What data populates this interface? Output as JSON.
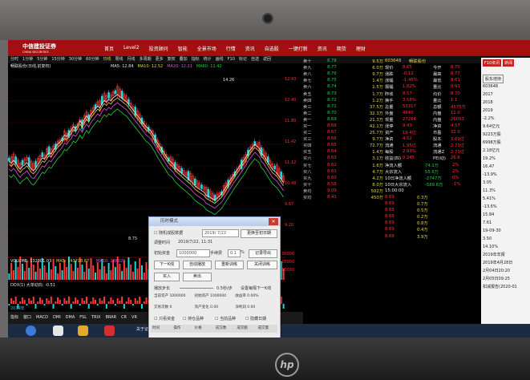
{
  "topbar": {
    "logo": "中信建投证券",
    "logo_sub": "CHINA SECURITIES",
    "nav": [
      "首页",
      "Level2",
      "投资顾问",
      "智能",
      "全景市场",
      "行情",
      "资讯",
      "自选股",
      "一键打新",
      "资讯",
      "期货",
      "理财"
    ],
    "level2_badge": "HOT"
  },
  "menu_tabs": [
    "分时",
    "1分钟",
    "5分钟",
    "15分钟",
    "30分钟",
    "60分钟",
    "日线",
    "周线",
    "月线",
    "多周期",
    "更多",
    "复权",
    "叠加",
    "指标",
    "统计",
    "画线",
    "F10",
    "标记",
    "自选",
    "返回"
  ],
  "chart": {
    "title": "畅联股份(日线,前复权)",
    "ma_labels": [
      {
        "text": "MA5: 12.84",
        "color": "#e6e6e6"
      },
      {
        "text": "MA10: 12.52",
        "color": "#e8d24a"
      },
      {
        "text": "MA20: 12.21",
        "color": "#e050e0"
      },
      {
        "text": "MA60: 11.42",
        "color": "#20d040"
      }
    ],
    "price_high": "14.26",
    "price_low": "8.75",
    "y_ticks": [
      "12.93",
      "12.40",
      "11.80",
      "11.42",
      "11.12",
      "10.48",
      "9.87",
      "9.20"
    ],
    "y_pcts": [
      "19.9%",
      "13.3%",
      "9.6%",
      "3.1%",
      "-3.7%",
      "-9.9%",
      "-16.2%"
    ],
    "volume_label": "VOLUME: 132801.03",
    "vol_ma5": "MA5: 143718.87",
    "vol_ma10": "MA10: 188026",
    "vol_ticks": [
      "30000",
      "20000",
      "10000"
    ],
    "ddx_label": "DDX(1) 大单动向: -0.51",
    "year_label": "2019年",
    "indicator_tabs": [
      "指标",
      "窗口",
      "MACD",
      "DMI",
      "DMA",
      "FSL",
      "TRIX",
      "BRAR",
      "CR",
      "VR"
    ],
    "indicator_tabs2": [
      "扩展",
      "大单",
      "资金博弈",
      "资金分布",
      "大单资金",
      "选股",
      "综合资讯",
      "行业资讯"
    ],
    "orders_label": "交易",
    "order_labels": [
      "DDX"
    ]
  },
  "orderbook": {
    "sells": [
      {
        "label": "卖十",
        "price": "8.78",
        "vol": "9.5万"
      },
      {
        "label": "卖九",
        "price": "8.77",
        "vol": "6.0万"
      },
      {
        "label": "卖八",
        "price": "8.76",
        "vol": "9.7万"
      },
      {
        "label": "卖七",
        "price": "8.75",
        "vol": "1.4万"
      },
      {
        "label": "卖六",
        "price": "8.74",
        "vol": "1.5万"
      },
      {
        "label": "卖五",
        "price": "8.73",
        "vol": "1.7万"
      },
      {
        "label": "卖四",
        "price": "8.72",
        "vol": "1.2万"
      },
      {
        "label": "卖三",
        "price": "8.71",
        "vol": "37.5万"
      },
      {
        "label": "卖二",
        "price": "8.70",
        "vol": "32.3万"
      },
      {
        "label": "卖一",
        "price": "8.69",
        "vol": "21.3万"
      }
    ],
    "buys": [
      {
        "label": "买一",
        "price": "8.68",
        "vol": "42.1万"
      },
      {
        "label": "买二",
        "price": "8.67",
        "vol": "25.7万"
      },
      {
        "label": "买三",
        "price": "8.66",
        "vol": "9.7万"
      },
      {
        "label": "买四",
        "price": "8.65",
        "vol": "72.7万"
      },
      {
        "label": "买五",
        "price": "8.64",
        "vol": "1.4万"
      },
      {
        "label": "买六",
        "price": "8.63",
        "vol": "3.1万"
      },
      {
        "label": "买七",
        "price": "8.62",
        "vol": "1.6万"
      },
      {
        "label": "买八",
        "price": "8.61",
        "vol": "4.7万"
      },
      {
        "label": "买九",
        "price": "8.60",
        "vol": "4.2万"
      },
      {
        "label": "买十",
        "price": "8.58",
        "vol": "8.0万"
      }
    ],
    "avg_sell": {
      "label": "卖均",
      "price": "9.09",
      "name": "总卖",
      "vol": "502万"
    },
    "avg_buy": {
      "label": "买均",
      "price": "8.41",
      "name": "总买",
      "vol": "450万"
    }
  },
  "quote": {
    "code": "603648",
    "name": "畅联股份",
    "rows": [
      {
        "k": "现价",
        "v": "8.65",
        "k2": "今开",
        "v2": "8.70"
      },
      {
        "k": "涨跌",
        "v": "-0.12",
        "k2": "最高",
        "v2": "8.77"
      },
      {
        "k": "涨幅",
        "v": "-1.45%",
        "k2": "最低",
        "v2": "8.61"
      },
      {
        "k": "振幅",
        "v": "1.82%",
        "k2": "量比",
        "v2": "0.93"
      },
      {
        "k": "昨收",
        "v": "8.57",
        "k2": "均价",
        "v2": "8.70"
      },
      {
        "k": "换手",
        "v": "3.58%",
        "k2": "量比",
        "v2": "1.1"
      },
      {
        "k": "总量",
        "v": "53317",
        "k2": "总额",
        "v2": "4575万"
      },
      {
        "k": "外盘",
        "v": "4840",
        "k2": "内盘",
        "v2": "11.0"
      },
      {
        "k": "现量",
        "v": "27264",
        "k2": "内盘",
        "v2": "26053"
      },
      {
        "k": "涨停",
        "v": "9.43",
        "k2": "净资",
        "v2": "4.57"
      },
      {
        "k": "资产",
        "v": "19.4亿",
        "k2": "市盈",
        "v2": "32.0"
      },
      {
        "k": "净资",
        "v": "4.52",
        "k2": "股本",
        "v2": "3.69亿"
      },
      {
        "k": "流通",
        "v": "1.95亿",
        "k2": "流通",
        "v2": "2.73亿"
      },
      {
        "k": "每股",
        "v": "2.93%",
        "k2": "流通Z",
        "v2": "2.73亿"
      },
      {
        "k": "收益(四)",
        "v": "0.245",
        "k2": "PE(动)",
        "v2": "26.6"
      }
    ],
    "flows": [
      {
        "k": "净流入额",
        "v": "74.1万",
        "pct": "2%"
      },
      {
        "k": "大宗流入",
        "v": "55.6万",
        "pct": "2%"
      },
      {
        "k": "10日净流入额",
        "v": "-2747万",
        "pct": "0%"
      },
      {
        "k": "10日大宗流入",
        "v": "-589.6万",
        "pct": "-1%"
      }
    ],
    "time": "15:00:00",
    "ticks": [
      {
        "p": "8.69",
        "v": "0.3万"
      },
      {
        "p": "8.69",
        "v": "0.7万"
      },
      {
        "p": "8.68",
        "v": "0.5万"
      },
      {
        "p": "8.68",
        "v": "0.2万"
      },
      {
        "p": "8.69",
        "v": "0.8万"
      },
      {
        "p": "8.69",
        "v": "0.4万"
      },
      {
        "p": "8.68",
        "v": "3.9万"
      },
      {
        "p": "8.68",
        "v": "15.3万"
      },
      {
        "p": "8.68",
        "v": "0.7万"
      },
      {
        "p": "8.69",
        "v": "1.0万"
      },
      {
        "p": "8.69",
        "v": "0.3万"
      },
      {
        "p": "8.69",
        "v": "0.3万"
      },
      {
        "p": "8.69",
        "v": "0.7万"
      },
      {
        "p": "8.69",
        "v": "0.5万"
      },
      {
        "p": "8.69",
        "v": "0.2万"
      }
    ]
  },
  "right_panel": {
    "btn1": "F10资讯",
    "btn2": "新闻",
    "btn3": "股东增持",
    "code": "603648",
    "lines": [
      "2017",
      "2018",
      "2019",
      "-2.2%",
      "9.64亿元",
      "9223万股",
      "6998万股",
      "2.18亿元",
      "19.2%",
      "16.47",
      "-13.9%",
      "3.05",
      "11.3%",
      "5.41%",
      "-13.6%",
      "15.84",
      "7.61",
      "19-09-30",
      "3.50",
      "14.10%",
      "2019年年报",
      "2019年4月28日",
      "2月04日20:20",
      "2月05日09:25",
      "扣减报告(2020-01"
    ]
  },
  "dialog": {
    "title": "历时模式",
    "checkbox_label": "随机成股数据",
    "date_value": "2019/ 7/22",
    "random_btn": "更换至初日期",
    "time_label": "调整时间",
    "time_value": "2019/7/22, 11:31",
    "funds_label": "初始资金",
    "funds_value": "1000000",
    "fee_label": "手续费",
    "fee_value": "0.1",
    "fee_unit": "%",
    "record_btn": "记录导出",
    "next_btn": "下一K线",
    "auto_btn": "自动播放",
    "restart_btn": "重新训练",
    "close_btn": "关闭训练",
    "buy_btn": "买入",
    "sell_btn": "卖出",
    "speed_label": "播放步长",
    "speed_value": "0.5秒/步",
    "speed_hint": "设置每隔下一K线",
    "stat_labels": [
      "当前资产",
      "初始资产",
      "收益率",
      "交易次数",
      "资产变化",
      "净利润"
    ],
    "stat_values": [
      "1000000",
      "1000000",
      "0.00%",
      "0",
      "0.00",
      "0.00"
    ],
    "opt1": "只看资金",
    "opt2": "持仓品种",
    "opt3": "当前品种",
    "opt4": "隐藏日期",
    "table_headers": [
      "时间",
      "操作",
      "价格",
      "成交数",
      "成交额",
      "成交量"
    ]
  },
  "bottom": {
    "tabs": [
      "刷新",
      "日线",
      "分时",
      "周线",
      "月线"
    ],
    "ticker": "关于证券信息的重大更新通知"
  }
}
